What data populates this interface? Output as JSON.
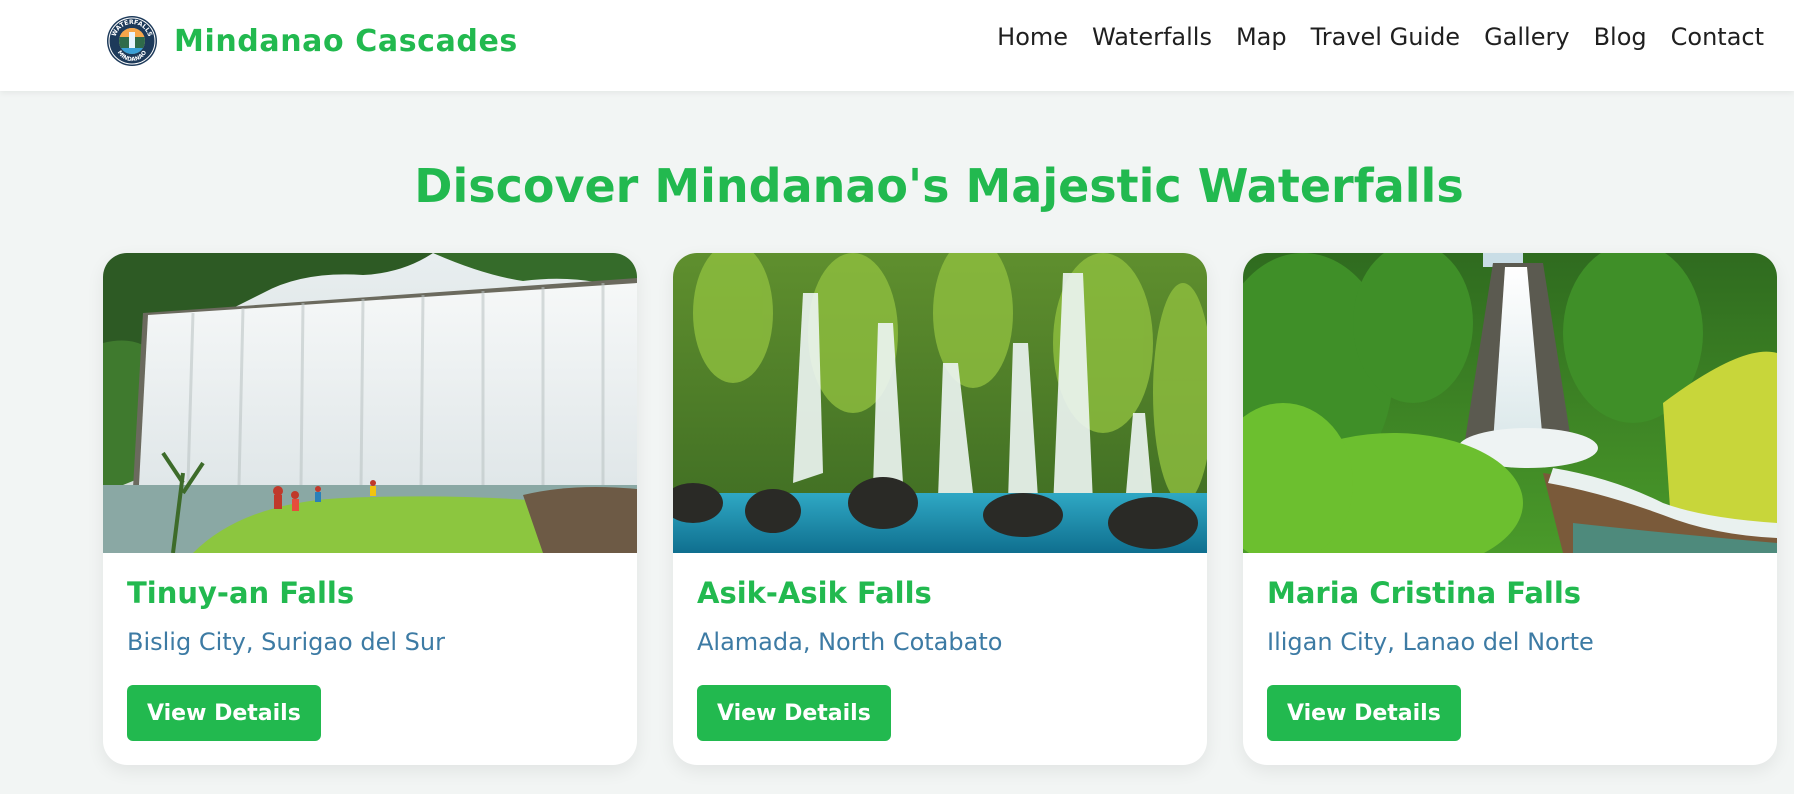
{
  "header": {
    "logo_icon": "waterfalls-mindanao-seal-logo",
    "logo_text_top": "WATERFALLS",
    "logo_text_bottom": "MINDANAO",
    "site_name": "Mindanao Cascades",
    "nav": [
      {
        "label": "Home"
      },
      {
        "label": "Waterfalls"
      },
      {
        "label": "Map"
      },
      {
        "label": "Travel Guide"
      },
      {
        "label": "Gallery"
      },
      {
        "label": "Blog"
      },
      {
        "label": "Contact"
      }
    ]
  },
  "main": {
    "title": "Discover Mindanao's Majestic Waterfalls",
    "cards": [
      {
        "name": "Tinuy-an Falls",
        "location": "Bislig City, Surigao del Sur",
        "button": "View Details",
        "image_icon": "tinuy-an-falls-photo"
      },
      {
        "name": "Asik-Asik Falls",
        "location": "Alamada, North Cotabato",
        "button": "View Details",
        "image_icon": "asik-asik-falls-photo"
      },
      {
        "name": "Maria Cristina Falls",
        "location": "Iligan City, Lanao del Norte",
        "button": "View Details",
        "image_icon": "maria-cristina-falls-photo"
      }
    ]
  },
  "colors": {
    "accent_green": "#22b94f",
    "location_blue": "#3d7ba4",
    "page_background": "#f2f5f4",
    "nav_text": "#1f1f1f"
  }
}
